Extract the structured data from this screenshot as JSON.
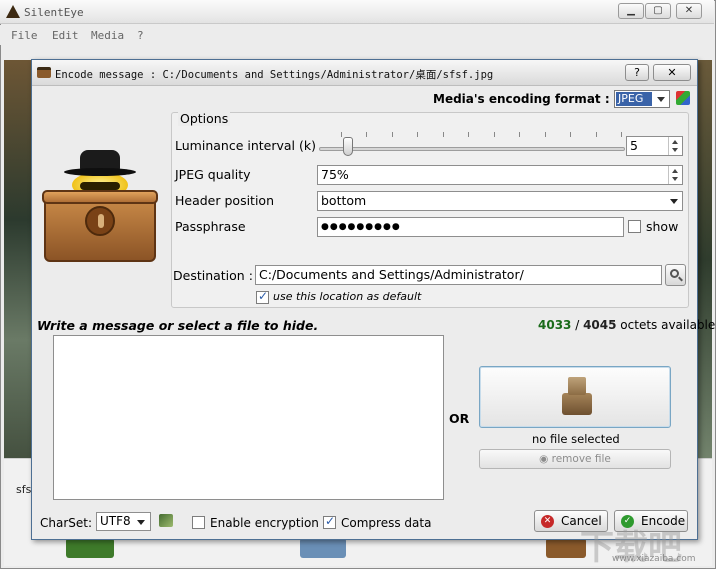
{
  "main_window": {
    "title": "SilentEye",
    "menu": [
      "File",
      "Edit",
      "Media",
      "?"
    ],
    "background_label": "sfs"
  },
  "dialog": {
    "title": "Encode message : C:/Documents and Settings/Administrator/桌面/sfsf.jpg",
    "help_label": "?",
    "close_label": "✕"
  },
  "media_format": {
    "label": "Media's encoding format :",
    "value": "JPEG"
  },
  "options": {
    "title": "Options",
    "luminance_label": "Luminance interval (k)",
    "luminance_value": "5",
    "luminance_fraction": 0.08,
    "jpeg_quality_label": "JPEG quality",
    "jpeg_quality_value": "75%",
    "header_position_label": "Header position",
    "header_position_value": "bottom",
    "passphrase_label": "Passphrase",
    "passphrase_value": "●●●●●●●●●",
    "show_label": "show",
    "destination_label": "Destination :",
    "destination_value": "C:/Documents and Settings/Administrator/",
    "use_default_label": "use this location as default"
  },
  "message": {
    "prompt": "Write a message or select a file to hide.",
    "octets_available": "4033",
    "octets_separator": " / ",
    "octets_total": "4045",
    "octets_suffix": " octets available",
    "or_label": "OR",
    "no_file_label": "no file selected",
    "remove_file_label": "remove file"
  },
  "bottom": {
    "charset_label": "CharSet:",
    "charset_value": "UTF8",
    "enable_encryption_label": "Enable encryption",
    "compress_data_label": "Compress data",
    "cancel_label": "Cancel",
    "encode_label": "Encode"
  },
  "watermark": {
    "text": "下载吧",
    "sub": "www.xiazaiba.com"
  },
  "colors": {
    "dialog_border": "#4d6f93",
    "selection": "#3a63a8",
    "octets_available": "#1a6b1a",
    "cancel_icon": "#c62828",
    "encode_icon": "#2e9a2e"
  }
}
